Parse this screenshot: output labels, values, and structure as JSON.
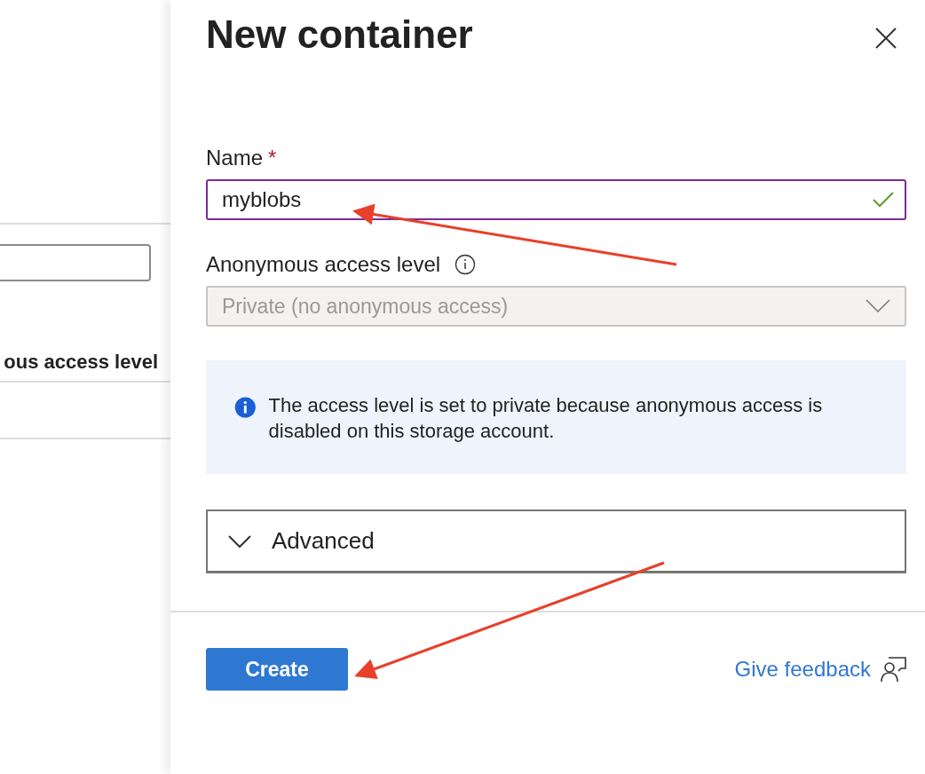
{
  "background": {
    "column_header": "ous access level"
  },
  "panel": {
    "title": "New container",
    "name_field": {
      "label": "Name",
      "required_mark": "*",
      "value": "myblobs",
      "valid": true
    },
    "access_field": {
      "label": "Anonymous access level",
      "value": "Private (no anonymous access)",
      "disabled": true
    },
    "info_message": "The access level is set to private because anonymous access is disabled on this storage account.",
    "advanced": {
      "label": "Advanced",
      "expanded": false
    },
    "create_button": "Create",
    "feedback_link": "Give feedback"
  }
}
